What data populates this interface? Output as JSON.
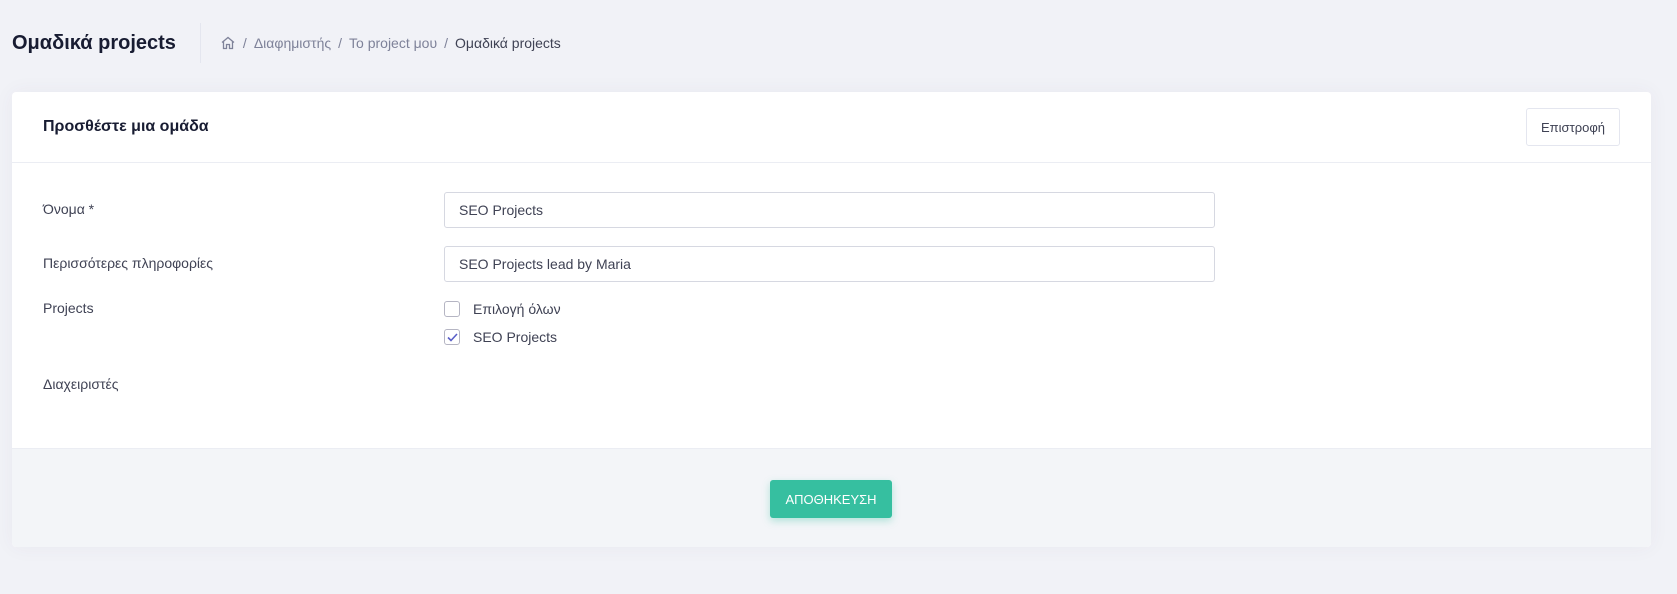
{
  "page": {
    "title": "Ομαδικά projects"
  },
  "breadcrumb": {
    "home_icon": "home-icon",
    "separator": "/",
    "items": [
      "Διαφημιστής",
      "Το project μου",
      "Ομαδικά projects"
    ]
  },
  "card": {
    "title": "Προσθέστε μια ομάδα",
    "back_label": "Επιστροφή"
  },
  "form": {
    "name_label": "Όνομα *",
    "name_value": "SEO Projects",
    "info_label": "Περισσότερες πληροφορίες",
    "info_value": "SEO Projects lead by Maria",
    "projects_label": "Projects",
    "projects": [
      {
        "label": "Επιλογή όλων",
        "checked": false
      },
      {
        "label": "SEO Projects",
        "checked": true
      }
    ],
    "managers_label": "Διαχειριστές"
  },
  "footer": {
    "save_label": "ΑΠΟΘΗΚΕΥΣΗ"
  },
  "colors": {
    "accent": "#36bfa0",
    "background": "#f1f2f7",
    "check": "#5a5fc7"
  }
}
